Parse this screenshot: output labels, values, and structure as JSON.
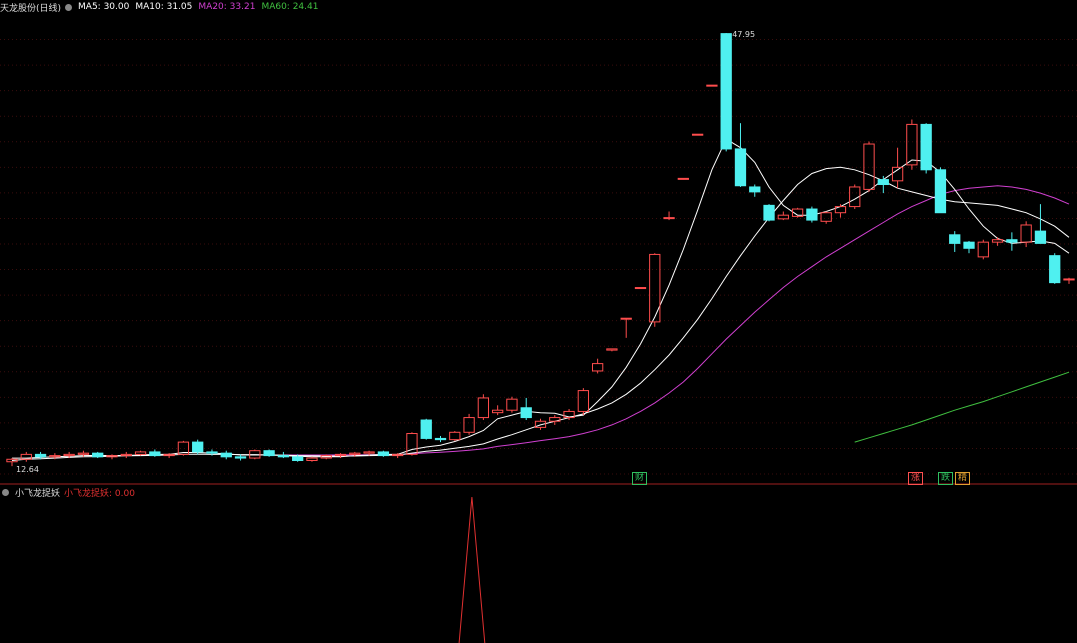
{
  "header": {
    "title": "天龙股份(日线)",
    "ma5": "MA5: 30.00",
    "ma10": "MA10: 31.05",
    "ma20": "MA20: 33.21",
    "ma60": "MA60: 24.41"
  },
  "indicator": {
    "title": "小飞龙捉妖",
    "label": "小飞龙捉妖: 0.00"
  },
  "labels": {
    "max_price": "47.95",
    "min_price": "12.64"
  },
  "event_tags": [
    {
      "text": "财",
      "color": "#30c060"
    },
    {
      "text": "涨",
      "color": "#ff5050"
    },
    {
      "text": "跌",
      "color": "#30c060"
    },
    {
      "text": "精",
      "color": "#e0a030"
    }
  ],
  "colors": {
    "up": "#ff4d4d",
    "down": "#4ff0f0",
    "ma5": "#ffffff",
    "ma10": "#ffffff",
    "ma20": "#d040d0",
    "ma60": "#40c040",
    "separator": "#a02020",
    "indicator": "#e03030"
  },
  "chart_data": {
    "type": "candlestick",
    "price_range": [
      12.0,
      49.5
    ],
    "candles": [
      [
        13.0,
        13.3,
        12.64,
        13.2
      ],
      [
        13.2,
        13.8,
        13.0,
        13.6
      ],
      [
        13.6,
        13.8,
        13.2,
        13.4
      ],
      [
        13.4,
        13.7,
        13.2,
        13.5
      ],
      [
        13.5,
        13.8,
        13.3,
        13.6
      ],
      [
        13.6,
        13.9,
        13.4,
        13.7
      ],
      [
        13.7,
        13.8,
        13.3,
        13.4
      ],
      [
        13.4,
        13.6,
        13.2,
        13.5
      ],
      [
        13.5,
        13.8,
        13.3,
        13.6
      ],
      [
        13.6,
        13.9,
        13.5,
        13.8
      ],
      [
        13.8,
        14.0,
        13.4,
        13.5
      ],
      [
        13.5,
        13.7,
        13.3,
        13.6
      ],
      [
        13.6,
        14.7,
        13.5,
        14.6
      ],
      [
        14.6,
        14.8,
        13.6,
        13.8
      ],
      [
        13.8,
        14.0,
        13.5,
        13.7
      ],
      [
        13.7,
        13.9,
        13.2,
        13.4
      ],
      [
        13.4,
        13.6,
        13.1,
        13.3
      ],
      [
        13.3,
        14.0,
        13.2,
        13.9
      ],
      [
        13.9,
        14.0,
        13.4,
        13.5
      ],
      [
        13.5,
        13.8,
        13.3,
        13.4
      ],
      [
        13.4,
        13.6,
        13.0,
        13.1
      ],
      [
        13.1,
        13.4,
        13.0,
        13.3
      ],
      [
        13.3,
        13.6,
        13.2,
        13.5
      ],
      [
        13.5,
        13.7,
        13.3,
        13.6
      ],
      [
        13.6,
        13.8,
        13.4,
        13.7
      ],
      [
        13.7,
        13.9,
        13.5,
        13.8
      ],
      [
        13.8,
        13.9,
        13.4,
        13.5
      ],
      [
        13.5,
        13.7,
        13.3,
        13.6
      ],
      [
        13.6,
        15.4,
        13.5,
        15.3
      ],
      [
        16.4,
        16.5,
        14.8,
        14.9
      ],
      [
        14.9,
        15.1,
        14.6,
        14.8
      ],
      [
        14.8,
        15.5,
        14.7,
        15.4
      ],
      [
        15.4,
        16.9,
        15.2,
        16.6
      ],
      [
        16.6,
        18.5,
        16.4,
        18.2
      ],
      [
        17.0,
        17.6,
        16.8,
        17.2
      ],
      [
        17.2,
        18.3,
        17.0,
        18.1
      ],
      [
        17.4,
        18.2,
        16.4,
        16.6
      ],
      [
        15.8,
        16.5,
        15.6,
        16.3
      ],
      [
        16.3,
        16.8,
        16.0,
        16.6
      ],
      [
        16.6,
        17.3,
        16.4,
        17.1
      ],
      [
        17.1,
        19.0,
        16.8,
        18.8
      ],
      [
        20.4,
        21.4,
        20.2,
        21.0
      ],
      [
        22.1,
        22.2,
        22.0,
        22.2
      ],
      [
        24.7,
        24.7,
        23.1,
        24.7
      ],
      [
        27.2,
        27.2,
        27.1,
        27.2
      ],
      [
        24.4,
        30.0,
        24.0,
        29.9
      ],
      [
        32.9,
        33.4,
        32.7,
        32.9
      ],
      [
        36.1,
        36.1,
        36.0,
        36.1
      ],
      [
        39.7,
        39.7,
        39.7,
        39.7
      ],
      [
        43.7,
        43.7,
        43.6,
        43.7
      ],
      [
        47.9,
        47.95,
        38.3,
        38.5
      ],
      [
        38.5,
        40.6,
        35.4,
        35.5
      ],
      [
        35.4,
        35.6,
        34.6,
        35.0
      ],
      [
        33.9,
        34.0,
        32.6,
        32.7
      ],
      [
        32.8,
        33.4,
        32.7,
        33.1
      ],
      [
        33.0,
        33.7,
        32.9,
        33.6
      ],
      [
        33.6,
        33.8,
        32.5,
        32.7
      ],
      [
        32.6,
        33.4,
        32.4,
        33.3
      ],
      [
        33.3,
        34.0,
        32.9,
        33.8
      ],
      [
        33.8,
        35.6,
        33.6,
        35.4
      ],
      [
        35.2,
        39.1,
        35.0,
        38.9
      ],
      [
        36.0,
        36.3,
        34.9,
        35.6
      ],
      [
        35.9,
        38.6,
        35.3,
        37.0
      ],
      [
        37.2,
        40.9,
        36.8,
        40.5
      ],
      [
        40.5,
        40.6,
        36.5,
        36.8
      ],
      [
        36.8,
        37.0,
        33.3,
        33.3
      ],
      [
        31.5,
        31.8,
        30.1,
        30.8
      ],
      [
        30.9,
        31.0,
        30.0,
        30.4
      ],
      [
        29.7,
        31.1,
        29.5,
        30.9
      ],
      [
        30.9,
        31.3,
        30.6,
        31.1
      ],
      [
        31.1,
        31.7,
        30.2,
        30.9
      ],
      [
        30.9,
        32.6,
        30.5,
        32.3
      ],
      [
        31.8,
        34.0,
        30.9,
        30.8
      ],
      [
        29.8,
        30.0,
        27.5,
        27.6
      ],
      [
        27.9,
        28.0,
        27.5,
        27.9
      ]
    ],
    "ma5": [
      13.3,
      13.3,
      13.35,
      13.4,
      13.45,
      13.5,
      13.52,
      13.5,
      13.52,
      13.55,
      13.6,
      13.6,
      13.75,
      13.75,
      13.7,
      13.65,
      13.55,
      13.55,
      13.55,
      13.5,
      13.45,
      13.4,
      13.4,
      13.4,
      13.5,
      13.55,
      13.6,
      13.6,
      14.0,
      14.2,
      14.35,
      14.65,
      15.05,
      15.55,
      16.5,
      16.8,
      17.1,
      17.0,
      16.95,
      16.65,
      16.8,
      17.9,
      19.1,
      20.7,
      22.6,
      24.8,
      27.4,
      30.3,
      33.5,
      36.8,
      39.3,
      38.6,
      37.4,
      35.4,
      33.9,
      33.1,
      33.1,
      33.4,
      33.8,
      34.4,
      35.1,
      36.0,
      36.8,
      37.6,
      37.5,
      36.6,
      35.2,
      33.6,
      32.2,
      31.2,
      30.8,
      30.9,
      31.0,
      30.8,
      30.0
    ],
    "ma10": [
      13.1,
      13.2,
      13.25,
      13.3,
      13.35,
      13.4,
      13.42,
      13.45,
      13.48,
      13.5,
      13.52,
      13.55,
      13.6,
      13.62,
      13.6,
      13.6,
      13.58,
      13.58,
      13.56,
      13.54,
      13.5,
      13.48,
      13.47,
      13.47,
      13.47,
      13.5,
      13.52,
      13.55,
      13.7,
      13.85,
      13.95,
      14.1,
      14.25,
      14.45,
      14.85,
      15.2,
      15.6,
      16.0,
      16.3,
      16.6,
      16.9,
      17.3,
      17.8,
      18.5,
      19.4,
      20.5,
      21.7,
      23.1,
      24.6,
      26.3,
      28.1,
      29.8,
      31.4,
      32.9,
      34.3,
      35.6,
      36.5,
      36.9,
      37.0,
      36.8,
      36.4,
      35.9,
      35.3,
      35.0,
      34.7,
      34.4,
      34.2,
      34.1,
      34.0,
      33.9,
      33.6,
      33.3,
      32.8,
      32.2,
      31.3
    ],
    "ma20": [
      null,
      null,
      null,
      null,
      null,
      null,
      null,
      null,
      null,
      null,
      null,
      null,
      null,
      null,
      null,
      null,
      null,
      null,
      null,
      13.55,
      13.55,
      13.55,
      13.55,
      13.56,
      13.56,
      13.57,
      13.57,
      13.58,
      13.65,
      13.72,
      13.78,
      13.84,
      13.93,
      14.05,
      14.25,
      14.4,
      14.55,
      14.72,
      14.88,
      15.05,
      15.3,
      15.6,
      16.0,
      16.5,
      17.1,
      17.8,
      18.6,
      19.5,
      20.6,
      21.8,
      23.0,
      24.1,
      25.2,
      26.2,
      27.2,
      28.1,
      28.9,
      29.7,
      30.4,
      31.1,
      31.8,
      32.5,
      33.2,
      33.8,
      34.3,
      34.8,
      35.1,
      35.3,
      35.4,
      35.5,
      35.4,
      35.2,
      34.9,
      34.5,
      34.0
    ],
    "ma60": [
      null,
      null,
      null,
      null,
      null,
      null,
      null,
      null,
      null,
      null,
      null,
      null,
      null,
      null,
      null,
      null,
      null,
      null,
      null,
      null,
      null,
      null,
      null,
      null,
      null,
      null,
      null,
      null,
      null,
      null,
      null,
      null,
      null,
      null,
      null,
      null,
      null,
      null,
      null,
      null,
      null,
      null,
      null,
      null,
      null,
      null,
      null,
      null,
      null,
      null,
      null,
      null,
      null,
      null,
      null,
      null,
      null,
      null,
      null,
      14.6,
      14.95,
      15.3,
      15.65,
      16.0,
      16.4,
      16.8,
      17.2,
      17.55,
      17.9,
      18.3,
      18.7,
      19.1,
      19.5,
      19.9,
      20.3
    ],
    "indicator": {
      "range": [
        0,
        1
      ],
      "values": [
        0,
        0,
        0,
        0,
        0,
        0,
        0,
        0,
        0,
        0,
        0,
        0,
        0,
        0,
        0,
        0,
        0,
        0,
        0,
        0,
        0,
        0,
        0,
        0,
        0,
        0,
        0,
        0,
        0,
        0,
        0,
        0,
        1,
        0,
        0,
        0,
        0,
        0,
        0,
        0,
        0,
        0,
        0,
        0,
        0,
        0,
        0,
        0,
        0,
        0,
        0,
        0,
        0,
        0,
        0,
        0,
        0,
        0,
        0,
        0,
        0,
        0,
        0,
        0,
        0,
        0,
        0,
        0,
        0,
        0,
        0,
        0,
        0,
        0,
        0
      ]
    }
  }
}
